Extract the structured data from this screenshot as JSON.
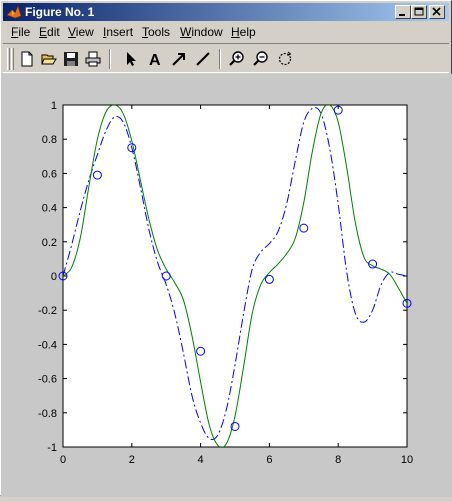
{
  "window": {
    "title": "Figure No. 1",
    "controls": [
      "minimize",
      "maximize",
      "close"
    ]
  },
  "menu": [
    {
      "label": "File",
      "key": "F",
      "rest": "ile"
    },
    {
      "label": "Edit",
      "key": "E",
      "rest": "dit"
    },
    {
      "label": "View",
      "key": "V",
      "rest": "iew"
    },
    {
      "label": "Insert",
      "key": "I",
      "rest": "nsert"
    },
    {
      "label": "Tools",
      "key": "T",
      "rest": "ools"
    },
    {
      "label": "Window",
      "key": "W",
      "rest": "indow"
    },
    {
      "label": "Help",
      "key": "H",
      "rest": "elp"
    }
  ],
  "toolbar": {
    "icons": [
      "new-figure-icon",
      "open-file-icon",
      "save-icon",
      "print-icon",
      "edit-plot-arrow-icon",
      "insert-text-icon",
      "insert-arrow-icon",
      "insert-line-icon",
      "zoom-in-icon",
      "zoom-out-icon",
      "rotate-3d-icon"
    ],
    "text_tool_label": "A"
  },
  "colors": {
    "titlebar_start": "#0a246a",
    "titlebar_end": "#a6caf0",
    "figure_background": "#c8c8c8",
    "axes_background": "#ffffff",
    "spline_color": "#0000ff",
    "sine_color": "#008000",
    "marker_color": "#0000ff"
  },
  "chart_data": {
    "type": "line",
    "xlim": [
      0,
      10
    ],
    "ylim": [
      -1,
      1
    ],
    "xticks": [
      0,
      2,
      4,
      6,
      8,
      10
    ],
    "yticks": [
      -1,
      -0.8,
      -0.6,
      -0.4,
      -0.2,
      0,
      0.2,
      0.4,
      0.6,
      0.8,
      1
    ],
    "xtick_labels": [
      "0",
      "2",
      "4",
      "6",
      "8",
      "10"
    ],
    "ytick_labels": [
      "-1",
      "-0.8",
      "-0.6",
      "-0.4",
      "-0.2",
      "0",
      "0.2",
      "0.4",
      "0.6",
      "0.8",
      "1"
    ],
    "grid": false,
    "series": [
      {
        "style": "markers-circle",
        "x": [
          0,
          1,
          2,
          3,
          4,
          5,
          6,
          7,
          8,
          9,
          10
        ],
        "y": [
          0,
          0.59,
          0.75,
          0.0,
          -0.44,
          -0.88,
          -0.02,
          0.28,
          0.97,
          0.07,
          -0.16
        ]
      },
      {
        "style": "dash-dot",
        "x": [
          0,
          0.25,
          0.5,
          0.75,
          1,
          1.25,
          1.5,
          1.75,
          2,
          2.25,
          2.5,
          2.75,
          3,
          3.25,
          3.5,
          3.75,
          4,
          4.25,
          4.5,
          4.75,
          5,
          5.25,
          5.5,
          5.75,
          6,
          6.25,
          6.5,
          6.75,
          7,
          7.25,
          7.5,
          7.75,
          8,
          8.25,
          8.5,
          8.75,
          9,
          9.25,
          9.5,
          9.75,
          10
        ],
        "y": [
          0,
          0.18,
          0.38,
          0.56,
          0.71,
          0.85,
          0.93,
          0.9,
          0.75,
          0.52,
          0.27,
          0.08,
          -0.05,
          -0.22,
          -0.45,
          -0.7,
          -0.86,
          -0.95,
          -0.93,
          -0.78,
          -0.52,
          -0.22,
          0.04,
          0.14,
          0.19,
          0.26,
          0.42,
          0.67,
          0.9,
          0.98,
          0.95,
          0.75,
          0.42,
          0.02,
          -0.22,
          -0.27,
          -0.2,
          -0.05,
          0.02,
          0.01,
          0
        ]
      },
      {
        "style": "solid",
        "x": [
          0,
          0.25,
          0.5,
          0.75,
          1,
          1.25,
          1.5,
          1.75,
          2,
          2.25,
          2.5,
          2.75,
          3,
          3.25,
          3.5,
          3.75,
          4,
          4.25,
          4.5,
          4.75,
          5,
          5.25,
          5.5,
          5.75,
          6,
          6.25,
          6.5,
          6.75,
          7,
          7.25,
          7.5,
          7.75,
          8,
          8.25,
          8.5,
          8.75,
          9,
          9.25,
          9.5,
          9.75,
          10
        ],
        "y": [
          0,
          0.05,
          0.22,
          0.52,
          0.8,
          0.96,
          1.0,
          0.95,
          0.79,
          0.56,
          0.33,
          0.15,
          0.04,
          -0.04,
          -0.14,
          -0.35,
          -0.62,
          -0.87,
          -0.99,
          -0.98,
          -0.82,
          -0.53,
          -0.22,
          -0.05,
          0.02,
          0.07,
          0.13,
          0.22,
          0.43,
          0.73,
          0.95,
          1.0,
          0.9,
          0.63,
          0.31,
          0.11,
          0.06,
          0.04,
          0.01,
          -0.07,
          -0.16
        ]
      }
    ]
  }
}
